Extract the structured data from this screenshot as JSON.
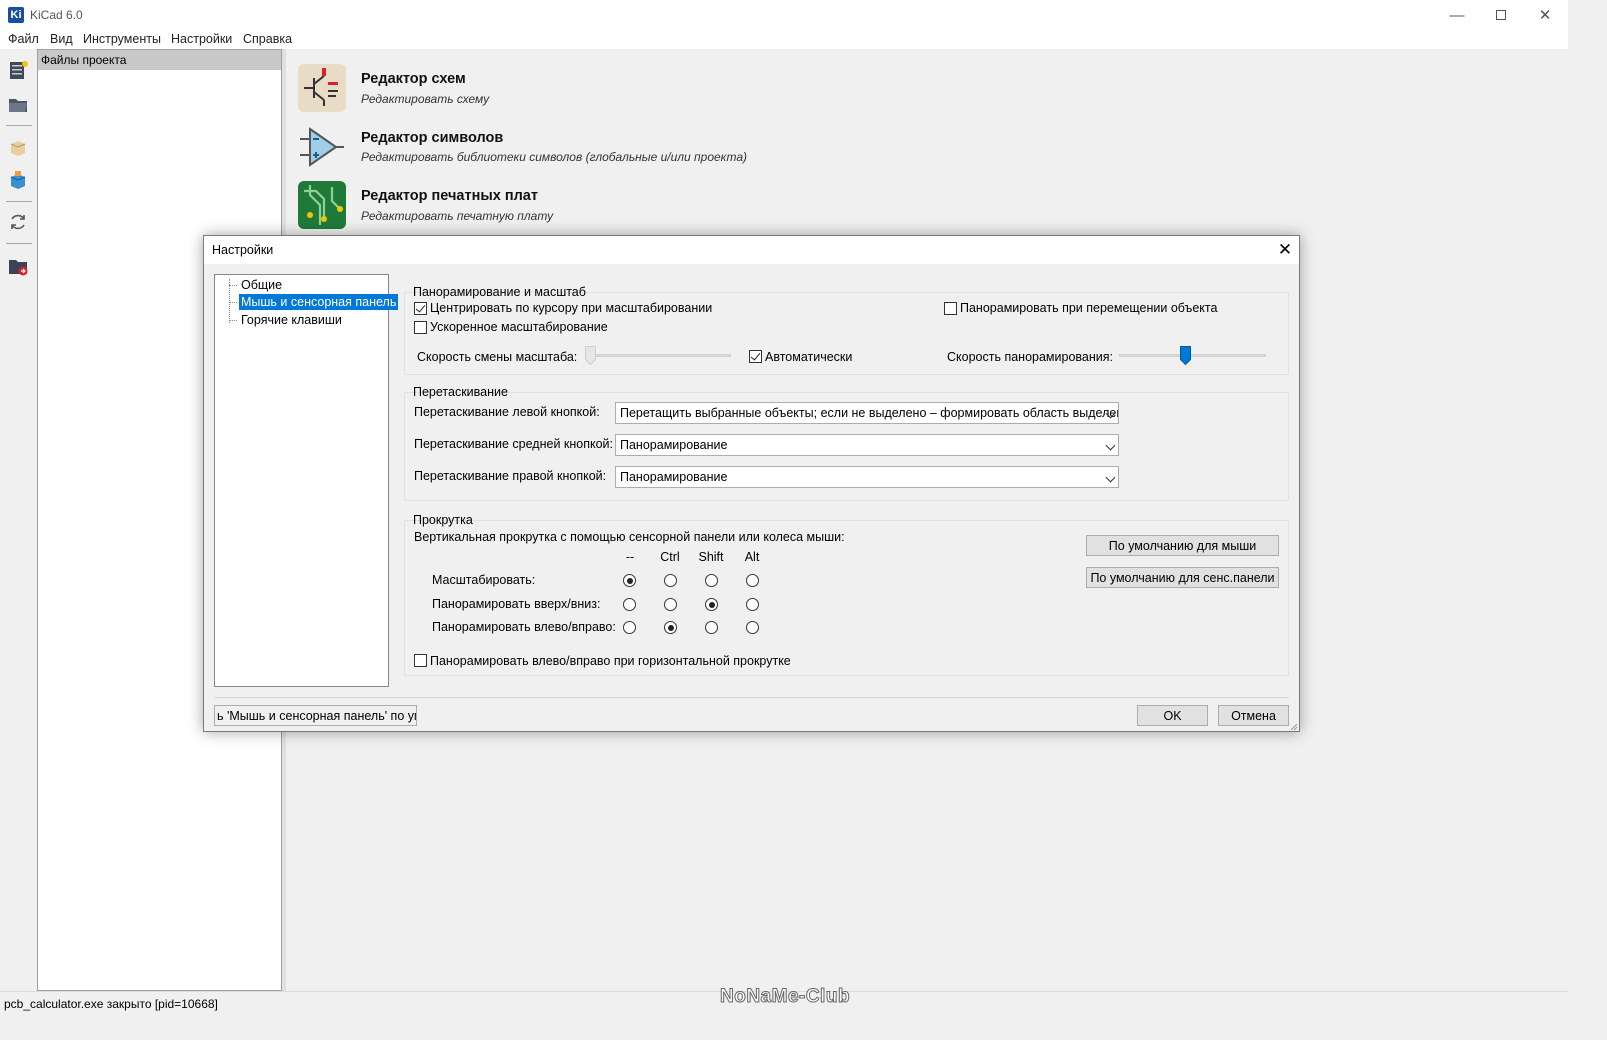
{
  "window": {
    "title": "KiCad 6.0",
    "logo": "Ki"
  },
  "menu": [
    "Файл",
    "Вид",
    "Инструменты",
    "Настройки",
    "Справка"
  ],
  "toolbar_icons": [
    "new-project-icon",
    "open-project-icon",
    "archive-icon",
    "unarchive-icon",
    "refresh-icon",
    "explore-folder-icon"
  ],
  "project_panel": {
    "header": "Файлы проекта"
  },
  "launchers": [
    {
      "title": "Редактор схем",
      "desc": "Редактировать схему"
    },
    {
      "title": "Редактор символов",
      "desc": "Редактировать библиотеки символов (глобальные и/или проекта)"
    },
    {
      "title": "Редактор печатных плат",
      "desc": "Редактировать печатную плату"
    }
  ],
  "status": {
    "text": "pcb_calculator.exe закрыто [pid=10668]",
    "watermark": "NoNaMe-Club"
  },
  "dialog": {
    "title": "Настройки",
    "tree": [
      {
        "label": "Общие",
        "selected": false
      },
      {
        "label": "Мышь и сенсорная панель",
        "selected": true
      },
      {
        "label": "Горячие клавиши",
        "selected": false
      }
    ],
    "pan_zoom": {
      "label": "Панорамирование и масштаб",
      "center_cursor": {
        "label": "Центрировать по курсору при масштабировании",
        "checked": true
      },
      "pan_moving": {
        "label": "Панорамировать при перемещении объекта",
        "checked": false
      },
      "accel_zoom": {
        "label": "Ускоренное масштабирование",
        "checked": false
      },
      "zoom_speed_label": "Скорость смены масштаба:",
      "zoom_speed_value": 0.0,
      "auto": {
        "label": "Автоматически",
        "checked": true
      },
      "pan_speed_label": "Скорость панорамирования:",
      "pan_speed_value": 0.45
    },
    "drag": {
      "label": "Перетаскивание",
      "rows": [
        {
          "label": "Перетаскивание левой кнопкой:",
          "value": "Перетащить выбранные объекты; если не выделено – формировать область выделения"
        },
        {
          "label": "Перетаскивание средней кнопкой:",
          "value": "Панорамирование"
        },
        {
          "label": "Перетаскивание правой кнопкой:",
          "value": "Панорамирование"
        }
      ]
    },
    "scroll": {
      "label": "Прокрутка",
      "desc": "Вертикальная прокрутка с помощью сенсорной панели или колеса мыши:",
      "columns": [
        "--",
        "Ctrl",
        "Shift",
        "Alt"
      ],
      "rows": [
        {
          "label": "Масштабировать:",
          "selected": 0
        },
        {
          "label": "Панорамировать вверх/вниз:",
          "selected": 2
        },
        {
          "label": "Панорамировать влево/вправо:",
          "selected": 1
        }
      ],
      "btn_mouse": "По умолчанию для мыши",
      "btn_touchpad": "По умолчанию для сенс.панели",
      "horiz_pan": {
        "label": "Панорамировать влево/вправо при горизонтальной прокрутке",
        "checked": false
      }
    },
    "reset_button": "ь 'Мышь и сенсорная панель' по умо",
    "ok": "OK",
    "cancel": "Отмена"
  }
}
